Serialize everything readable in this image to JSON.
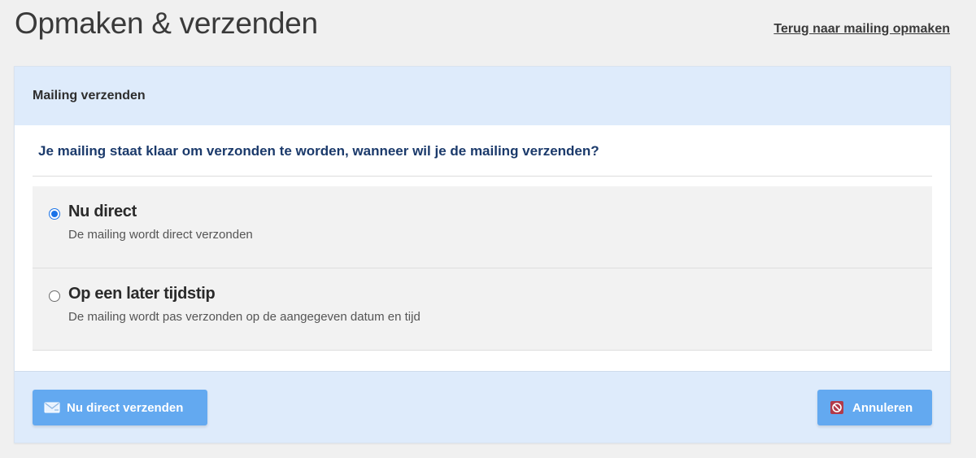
{
  "header": {
    "title": "Opmaken & verzenden",
    "back_link": "Terug naar mailing opmaken"
  },
  "card": {
    "title": "Mailing verzenden",
    "question": "Je mailing staat klaar om verzonden te worden, wanneer wil je de mailing verzenden?",
    "options": [
      {
        "label": "Nu direct",
        "description": "De mailing wordt direct verzonden",
        "selected": true
      },
      {
        "label": "Op een later tijdstip",
        "description": "De mailing wordt pas verzonden op de aangegeven datum en tijd",
        "selected": false
      }
    ]
  },
  "footer": {
    "send_label": "Nu direct verzenden",
    "send_icon": "envelope-icon",
    "cancel_label": "Annuleren",
    "cancel_icon": "cancel-icon"
  },
  "colors": {
    "accent": "#63a9f0",
    "header_bg": "#deebfb",
    "question_text": "#1b3a6b",
    "radio_selected": "#1a73e8"
  }
}
